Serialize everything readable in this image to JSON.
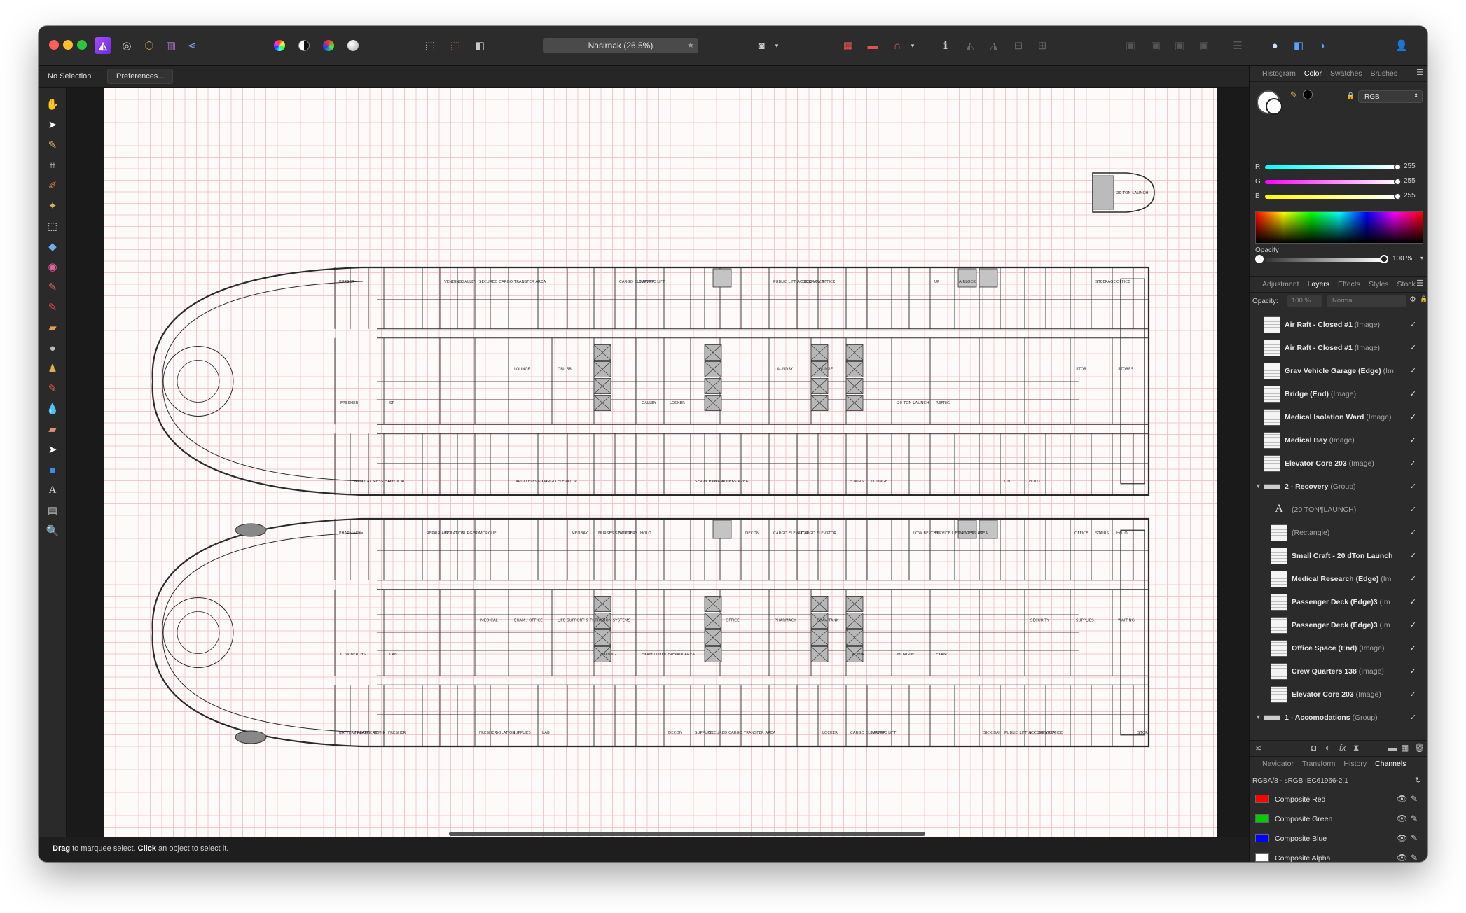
{
  "window": {
    "document_title": "Nasirnak (26.5%)",
    "traffic_colors": [
      "#ff5f57",
      "#febc2e",
      "#28c840"
    ]
  },
  "toolbar": {
    "persona_icons": [
      "designer-persona-icon",
      "pixel-persona-icon",
      "export-persona-icon",
      "liquify-persona-icon",
      "share-icon"
    ],
    "adjust_icons": [
      "auto-levels-icon",
      "auto-contrast-icon",
      "auto-colors-icon",
      "auto-white-balance-icon"
    ],
    "selection_icons": [
      "marquee-select-icon",
      "deselect-icon",
      "invert-selection-icon"
    ],
    "right_icons": [
      "snapping-icon",
      "order-back-icon",
      "order-forward-icon",
      "align-icon",
      "assistant-icon",
      "studio-icon",
      "account-icon"
    ]
  },
  "contextbar": {
    "selection_status": "No Selection",
    "preferences_label": "Preferences..."
  },
  "statusbar": {
    "bold1": "Drag",
    "text1": " to marquee select. ",
    "bold2": "Click",
    "text2": " an object to select it."
  },
  "tools": [
    "hand-tool-icon",
    "move-tool-icon",
    "color-picker-icon",
    "crop-tool-icon",
    "paint-brush-icon",
    "flood-select-icon",
    "marquee-tool-icon",
    "fill-tool-icon",
    "gradient-tool-icon",
    "paint-brush-tool-icon",
    "color-replacement-icon",
    "erase-brush-icon",
    "dodge-brush-icon",
    "clone-brush-icon",
    "healing-brush-icon",
    "blur-brush-icon",
    "sponge-brush-icon",
    "node-tool-icon",
    "rectangle-tool-icon",
    "text-tool-icon",
    "mesh-warp-icon",
    "zoom-tool-icon"
  ],
  "color_panel": {
    "tabs": [
      "Histogram",
      "Color",
      "Swatches",
      "Brushes"
    ],
    "active_tab": "Color",
    "mode": "RGB",
    "channels": [
      {
        "label": "R",
        "value": "255",
        "gradient": "linear-gradient(to right, #00ffff, #ffffff)"
      },
      {
        "label": "G",
        "value": "255",
        "gradient": "linear-gradient(to right, #ff00ff, #ffffff)"
      },
      {
        "label": "B",
        "value": "255",
        "gradient": "linear-gradient(to right, #ffff00, #ffffff)"
      }
    ],
    "opacity_label": "Opacity",
    "opacity_value": "100 %"
  },
  "layers_panel": {
    "tabs": [
      "Adjustment",
      "Layers",
      "Effects",
      "Styles",
      "Stock"
    ],
    "active_tab": "Layers",
    "opacity_label": "Opacity:",
    "opacity_value": "100 %",
    "blend_mode": "Normal",
    "layers": [
      {
        "name": "Air Raft - Closed #1",
        "kind": " (Image)",
        "indent": 0
      },
      {
        "name": "Air Raft - Closed #1",
        "kind": " (Image)",
        "indent": 0
      },
      {
        "name": "Grav Vehicle Garage (Edge)",
        "kind": " (Im",
        "indent": 0
      },
      {
        "name": "Bridge (End)",
        "kind": " (Image)",
        "indent": 0
      },
      {
        "name": "Medical Isolation Ward",
        "kind": " (Image)",
        "indent": 0
      },
      {
        "name": "Medical Bay",
        "kind": " (Image)",
        "indent": 0
      },
      {
        "name": "Elevator Core 203",
        "kind": " (Image)",
        "indent": 0
      },
      {
        "name": "2 - Recovery",
        "kind": " (Group)",
        "indent": 0,
        "group": true
      },
      {
        "name": "",
        "kind": "(20 TON¶LAUNCH)",
        "indent": 1,
        "text": true
      },
      {
        "name": "",
        "kind": "(Rectangle)",
        "indent": 1
      },
      {
        "name": "Small Craft - 20 dTon Launch",
        "kind": "",
        "indent": 1
      },
      {
        "name": "Medical Research (Edge)",
        "kind": " (Im",
        "indent": 1
      },
      {
        "name": "Passenger Deck (Edge)3",
        "kind": " (Im",
        "indent": 1
      },
      {
        "name": "Passenger Deck (Edge)3",
        "kind": " (Im",
        "indent": 1
      },
      {
        "name": "Office Space (End)",
        "kind": " (Image)",
        "indent": 1
      },
      {
        "name": "Crew Quarters 138",
        "kind": " (Image)",
        "indent": 1
      },
      {
        "name": "Elevator Core 203",
        "kind": " (Image)",
        "indent": 1
      },
      {
        "name": "1 - Accomodations",
        "kind": " (Group)",
        "indent": 0,
        "group": true
      }
    ]
  },
  "channels_panel": {
    "tabs": [
      "Navigator",
      "Transform",
      "History",
      "Channels"
    ],
    "active_tab": "Channels",
    "profile": "RGBA/8 - sRGB IEC61966-2.1",
    "channels": [
      {
        "name": "Composite Red",
        "color": "#ff0000"
      },
      {
        "name": "Composite Green",
        "color": "#00cc00"
      },
      {
        "name": "Composite Blue",
        "color": "#0000ff"
      },
      {
        "name": "Composite Alpha",
        "color": "#ffffff"
      }
    ]
  },
  "floorplan": {
    "upper_deck_labels": [
      "PURSER",
      "MEDICAL",
      "SECURED CARGO TRANSFER AREA",
      "CARGO ELEVATOR",
      "PRIVATE LIFT",
      "PRIVATE LIFT",
      "SECURITY OFFICE",
      "LOUNGE",
      "AIRLOCK",
      "HOLO",
      "OFFICE",
      "SR",
      "DBL SR",
      "LOCKER",
      "LOUNGE",
      "REFRIG",
      "STORES",
      "MESS HALL",
      "GALLEY",
      "CARGO ELEVATOR",
      "CARGO ELEVATOR",
      "SERVICE LIFT ACCESS AREA",
      "PUBLIC LIFT ACCESS AREA",
      "STAIRS",
      "UP",
      "DN",
      "STEERAGE",
      "FRESHER",
      "LOUNGE",
      "GALLEY",
      "LAUNDRY",
      "20 TON LAUNCH",
      "STOR",
      "MEDICAL",
      "VENDING"
    ],
    "lower_deck_labels": [
      "PHARMACY",
      "FRESHER",
      "MORGUE",
      "LAB",
      "HOLO",
      "SECURED CARGO TRANSFER AREA",
      "CARGO ELEVATOR",
      "PRIVATE LIFT",
      "PRIVATE LIFT",
      "SECURITY OFFICE",
      "HOLO",
      "LAB",
      "LIFE SUPPORT & FILTRATION SYSTEMS",
      "REPAIR AREA",
      "GRAV TANK",
      "EXAM",
      "WAITING",
      "ADMIN",
      "SURGERY",
      "SUPPLIES",
      "SURGERY",
      "SUPPLIES",
      "CARGO ELEVATOR",
      "CARGO ELEVATOR",
      "SERVICE LIFT ACCESS AREA",
      "PUBLIC LIFT ACCESS AREA",
      "STAIRS",
      "LOW BERTHS",
      "EXAM / OFFICE",
      "EXAM / OFFICE",
      "PHARMACY",
      "MORGUE",
      "SUPPLIES",
      "TREATMENT",
      "ISOLATION",
      "ISOLATION",
      "NURSES STATION",
      "DECON",
      "DECON",
      "LOCKER",
      "LOW BERTHS",
      "SICK BAY",
      "OFFICE",
      "STOR",
      "MEDICAL",
      "WAITING",
      "OFFICE",
      "ADMIN",
      "SECURITY",
      "BATTERY ROOM",
      "REPAIR AREA",
      "FRESHER",
      "MEDBAY"
    ],
    "launch_label": "20 TON LAUNCH"
  }
}
